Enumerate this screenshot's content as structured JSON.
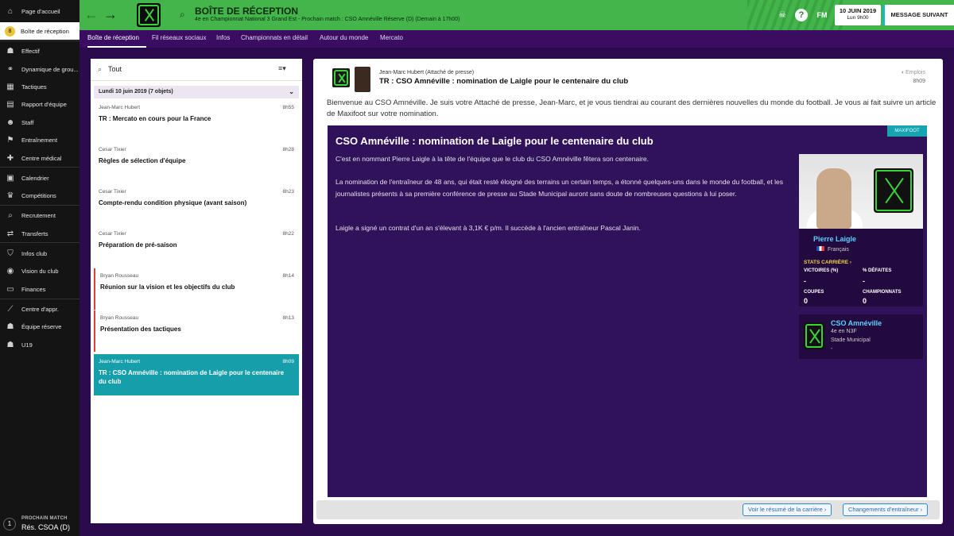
{
  "sidebar": {
    "items": [
      {
        "label": "Page d'accueil",
        "icon": "home-icon",
        "glyph": "⌂"
      },
      {
        "label": "Boîte de réception",
        "icon": "inbox-icon",
        "glyph": "8"
      },
      {
        "label": "Effectif",
        "icon": "squad-icon",
        "glyph": "☗"
      },
      {
        "label": "Dynamique de grou...",
        "icon": "dynamics-icon",
        "glyph": "⚭"
      },
      {
        "label": "Tactiques",
        "icon": "tactics-icon",
        "glyph": "▦"
      },
      {
        "label": "Rapport d'équipe",
        "icon": "report-icon",
        "glyph": "▤"
      },
      {
        "label": "Staff",
        "icon": "staff-icon",
        "glyph": "☻"
      },
      {
        "label": "Entraînement",
        "icon": "training-icon",
        "glyph": "⚑"
      },
      {
        "label": "Centre médical",
        "icon": "medical-icon",
        "glyph": "✚"
      },
      {
        "label": "Calendrier",
        "icon": "calendar-icon",
        "glyph": "▣"
      },
      {
        "label": "Compétitions",
        "icon": "trophy-icon",
        "glyph": "♛"
      },
      {
        "label": "Recrutement",
        "icon": "scouting-icon",
        "glyph": "⌕"
      },
      {
        "label": "Transferts",
        "icon": "transfers-icon",
        "glyph": "⇄"
      },
      {
        "label": "Infos club",
        "icon": "club-info-icon",
        "glyph": "⛉"
      },
      {
        "label": "Vision du club",
        "icon": "club-vision-icon",
        "glyph": "◉"
      },
      {
        "label": "Finances",
        "icon": "finances-icon",
        "glyph": "▭"
      },
      {
        "label": "Centre d'appr.",
        "icon": "development-centre-icon",
        "glyph": "⟋"
      },
      {
        "label": "Équipe réserve",
        "icon": "reserve-team-icon",
        "glyph": "☗"
      },
      {
        "label": "U19",
        "icon": "u19-icon",
        "glyph": "☗"
      }
    ],
    "inbox_count": "8",
    "next_match": {
      "label": "PROCHAIN MATCH",
      "value": "Rés. CSOA (D)",
      "day": "1"
    }
  },
  "topbar": {
    "title": "BOÎTE DE RÉCEPTION",
    "subtitle": "4e en Championnat National 3 Grand Est - Prochain match : CSO Amnéville Réserve (D) (Demain à 17h00)",
    "fm_label": "FM",
    "date": "10 JUIN 2019",
    "time": "Lun 9h00",
    "continue_label": "MESSAGE SUIVANT"
  },
  "tabs": [
    "Boîte de réception",
    "Fil réseaux sociaux",
    "Infos",
    "Championnats en détail",
    "Autour du monde",
    "Mercato"
  ],
  "inbox": {
    "filter_value": "Tout",
    "group_header": "Lundi 10 juin 2019 (7 objets)",
    "messages": [
      {
        "from": "Jean-Marc Hubert",
        "time": "8h55",
        "subject": "TR : Mercato en cours pour la France"
      },
      {
        "from": "Cesar Tixier",
        "time": "8h28",
        "subject": "Règles de sélection d'équipe"
      },
      {
        "from": "Cesar Tixier",
        "time": "8h23",
        "subject": "Compte-rendu condition physique (avant saison)"
      },
      {
        "from": "Cesar Tixier",
        "time": "8h22",
        "subject": "Préparation de pré-saison"
      },
      {
        "from": "Bryan Rousseau",
        "time": "8h14",
        "subject": "Réunion sur la vision et les objectifs du club"
      },
      {
        "from": "Bryan Rousseau",
        "time": "8h13",
        "subject": "Présentation des tactiques"
      },
      {
        "from": "Jean-Marc Hubert",
        "time": "8h09",
        "subject": "TR : CSO Amnéville : nomination de Laigle pour le centenaire du club"
      }
    ]
  },
  "message": {
    "sender": "Jean-Marc Hubert  (Attaché de presse)",
    "subject": "TR : CSO Amnéville : nomination de Laigle pour le centenaire du club",
    "category": "Emplois",
    "time": "8h09",
    "intro": "Bienvenue au CSO Amnéville. Je suis votre Attaché de presse, Jean-Marc, et je vous tiendrai au courant des dernières nouvelles du monde du football. Je vous ai fait suivre un article de Maxifoot sur votre nomination.",
    "news": {
      "source": "MAXIFOOT",
      "title": "CSO Amnéville : nomination de Laigle pour le centenaire du club",
      "paragraphs": [
        "C'est en nommant Pierre Laigle à la tête de l'équipe que le club du CSO Amnéville fêtera son centenaire.",
        "La nomination de l'entraîneur de 48 ans, qui était resté éloigné des terrains un certain temps, a étonné quelques-uns dans le monde du football, et les journalistes présents à sa première conférence de presse au Stade Municipal auront sans doute de nombreuses questions à lui poser.",
        "Laigle a signé un contrat d'un an s'élevant à 3,1K € p/m. Il succède à l'ancien entraîneur Pascal Janin."
      ]
    },
    "player": {
      "name": "Pierre Laigle",
      "nationality": "Français",
      "stats_label": "STATS CARRIÈRE",
      "stats": [
        {
          "label": "VICTOIRES (%)",
          "value": "-"
        },
        {
          "label": "% DÉFAITES",
          "value": "-"
        },
        {
          "label": "COUPES",
          "value": "0"
        },
        {
          "label": "CHAMPIONNATS",
          "value": "0"
        }
      ]
    },
    "club": {
      "name": "CSO Amnéville",
      "position": "4e en N3F",
      "stadium": "Stade Municipal",
      "extra": "-"
    },
    "buttons": [
      "Voir le résumé de la carrière",
      "Changements d'entraîneur"
    ]
  },
  "colors": {
    "accent_green": "#43b54b",
    "background_purple": "#2b0a4d",
    "selected_teal": "#179eab",
    "unread_red": "#e23b3b"
  }
}
